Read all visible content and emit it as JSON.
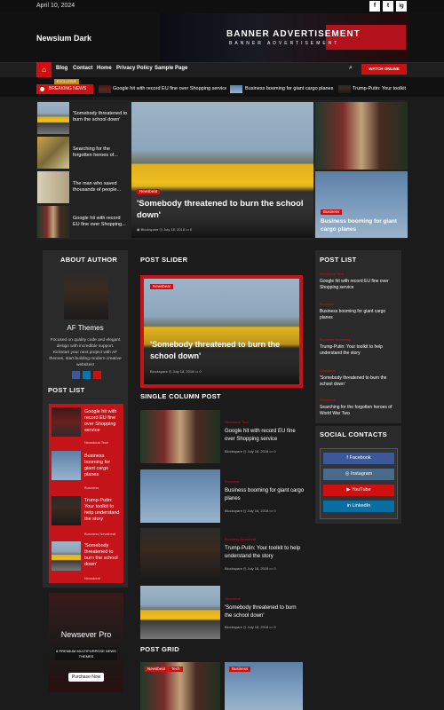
{
  "topbar": {
    "date": "April 10, 2024",
    "social": [
      "f",
      "t",
      "ig"
    ]
  },
  "header": {
    "site_title": "Newsium Dark",
    "banner_title": "BANNER ADVERTISEMENT",
    "banner_subtitle": "BANNER ADVERTISEMENT"
  },
  "nav": {
    "items": [
      "Blog",
      "Contact",
      "Home",
      "Privacy Policy",
      "Sample Page"
    ],
    "watch_label": "WATCH ONLINE"
  },
  "ticker": {
    "exclusive_label": "EXCLUSIVE",
    "breaking_label": "BREAKING NEWS",
    "items": [
      "Google hit with record EU fine over Shopping service",
      "Business booming for giant cargo planes",
      "Trump-Putin: Your toolkit"
    ]
  },
  "top_left_list": [
    {
      "title": "'Somebody threatened to burn the school down'"
    },
    {
      "title": "Searching for the forgotten heroes of..."
    },
    {
      "title": "The man who saved thousands of people..."
    },
    {
      "title": "Google hit with record EU fine over Shopping..."
    }
  ],
  "featured": {
    "category": "Newsbeat",
    "title": "'Somebody threatened to burn the school down'",
    "author": "Blockspare",
    "date": "July 18, 2018",
    "comments": "0"
  },
  "top_right": {
    "category": "Business",
    "title": "Business booming for giant cargo planes"
  },
  "about": {
    "heading": "ABOUT AUTHOR",
    "name": "AF Themes",
    "bio": "Focused on quality code and elegant design with incredible support. Kickstart your next project with AF themes, start building modern creative websites!"
  },
  "left_post_list": {
    "heading": "POST LIST",
    "items": [
      {
        "title": "Google hit with record EU fine over Shopping service",
        "cats": "Newsbeat  Tech"
      },
      {
        "title": "Business booming for giant cargo planes",
        "cats": "Business"
      },
      {
        "title": "Trump-Putin: Your toolkit to help understand the story",
        "cats": "Business  Newsbeat"
      },
      {
        "title": "'Somebody threatened to burn the school down'",
        "cats": "Newsbeat"
      }
    ]
  },
  "promo": {
    "title": "Newsever Pro",
    "sub": "8 PREMIUM MULTIPURPOSE NEWS THEMES",
    "button": "Purchase Now"
  },
  "post_slider": {
    "heading": "POST SLIDER",
    "category": "Newsbeat",
    "title": "'Somebody threatened to burn the school down'",
    "author": "Blockspare",
    "date": "July 18, 2018",
    "comments": "0"
  },
  "single_column": {
    "heading": "SINGLE COLUMN POST",
    "items": [
      {
        "cats": "Newsbeat  Tech",
        "title": "Google hit with record EU fine over Shopping service",
        "author": "Blockspare",
        "date": "July 18, 2018",
        "comments": "0"
      },
      {
        "cats": "Business",
        "title": "Business booming for giant cargo planes",
        "author": "Blockspare",
        "date": "July 18, 2018",
        "comments": "0"
      },
      {
        "cats": "Business  Newsbeat",
        "title": "Trump-Putin: Your toolkit to help understand the story",
        "author": "Blockspare",
        "date": "July 18, 2018",
        "comments": "0"
      },
      {
        "cats": "Newsbeat",
        "title": "'Somebody threatened to burn the school down'",
        "author": "Blockspare",
        "date": "July 18, 2018",
        "comments": "0"
      }
    ]
  },
  "post_grid": {
    "heading": "POST GRID",
    "cats": [
      "Newsbeat",
      "Tech",
      "Business"
    ]
  },
  "right_post_list": {
    "heading": "POST LIST",
    "items": [
      {
        "cats": "Newsbeat  Tech",
        "title": "Google hit with record EU fine over Shopping service"
      },
      {
        "cats": "Business",
        "title": "Business booming for giant cargo planes"
      },
      {
        "cats": "Business  Newsbeat",
        "title": "Trump-Putin: Your toolkit to help understand the story"
      },
      {
        "cats": "Newsbeat",
        "title": "'Somebody threatened to burn the school down'"
      },
      {
        "cats": "Newsbeat",
        "title": "Searching for the forgotten heroes of World War Two"
      }
    ]
  },
  "social_contacts": {
    "heading": "SOCIAL CONTACTS",
    "items": [
      "Facebook",
      "Instagram",
      "YouTube",
      "LinkedIn"
    ]
  },
  "colors": {
    "accent": "#d01010",
    "background": "#1b1b1b",
    "panel": "#2a2a2a"
  }
}
